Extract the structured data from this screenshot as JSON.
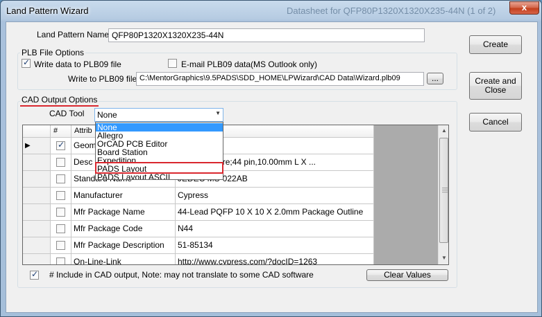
{
  "window": {
    "title": "Land Pattern Wizard",
    "background_title": "Datasheet for QFP80P1320X1320X235-44N (1 of 2)",
    "close_glyph": "x"
  },
  "land_pattern": {
    "label": "Land Pattern Name",
    "value": "QFP80P1320X1320X235-44N"
  },
  "plb": {
    "group_title": "PLB File Options",
    "write_data_label": "Write data to PLB09 file",
    "write_data_checked": true,
    "email_label": "E-mail PLB09 data",
    "email_checked": false,
    "email_note": "(MS Outlook only)",
    "write_to_label": "Write to PLB09 file",
    "write_to_value": "C:\\MentorGraphics\\9.5PADS\\SDD_HOME\\LPWizard\\CAD Data\\Wizard.plb09",
    "browse_label": "..."
  },
  "cad": {
    "group_title": "CAD Output Options",
    "tool_label": "CAD Tool",
    "tool_value": "None",
    "options": [
      "None",
      "Allegro",
      "OrCAD PCB Editor",
      "Board Station",
      "Expedition",
      "PADS Layout",
      "PADS Layout ASCII"
    ],
    "selected_index": 0,
    "highlighted_option": "PADS Layout"
  },
  "grid": {
    "headers": [
      "#",
      "Attrib",
      ""
    ],
    "rows": [
      {
        "checked": true,
        "attribute": "Geom",
        "value": ""
      },
      {
        "checked": false,
        "attribute": "Desc",
        "value": "n pitch,square;44 pin,10.00mm L X ..."
      },
      {
        "checked": false,
        "attribute": "Standard Name",
        "value": "JEDEC MS-022AB"
      },
      {
        "checked": false,
        "attribute": "Manufacturer",
        "value": "Cypress"
      },
      {
        "checked": false,
        "attribute": "Mfr Package Name",
        "value": "44-Lead PQFP 10 X 10 X 2.0mm Package Outline"
      },
      {
        "checked": false,
        "attribute": "Mfr Package Code",
        "value": "N44"
      },
      {
        "checked": false,
        "attribute": "Mfr Package Description",
        "value": "51-85134"
      },
      {
        "checked": false,
        "attribute": "On-Line-Link",
        "value": "http://www.cypress.com/?docID=1263"
      }
    ]
  },
  "footer": {
    "include_checked": true,
    "include_note": "# Include in CAD output,  Note: may not translate to some CAD software",
    "clear_values_label": "Clear Values"
  },
  "buttons": {
    "create": "Create",
    "create_and_close": "Create and Close",
    "cancel": "Cancel"
  }
}
